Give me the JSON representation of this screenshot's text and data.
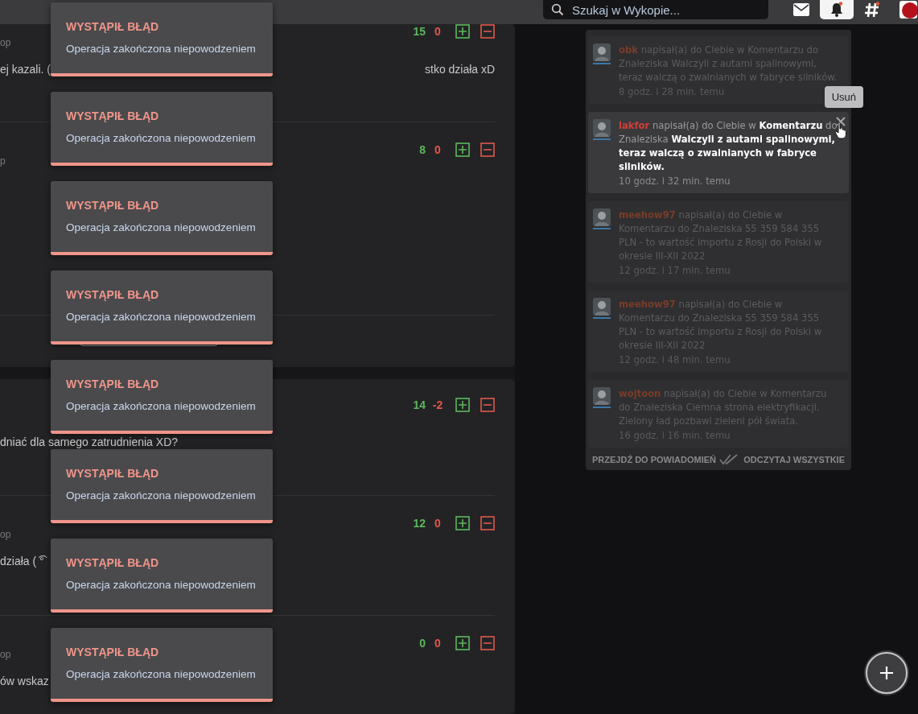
{
  "topbar": {
    "search": {
      "placeholder": "Szukaj w Wykopie..."
    },
    "nav": [
      {
        "kind": "mail",
        "selected": false
      },
      {
        "kind": "bell",
        "selected": true
      },
      {
        "kind": "hashtag",
        "selected": false
      },
      {
        "kind": "avatar",
        "selected": false
      }
    ]
  },
  "cards": [
    {
      "comments": [
        {
          "meta": "op",
          "text_parts": [
            "ej kazali. (",
            "stko działa xD"
          ],
          "votes_up": "15",
          "votes_down": "0"
        },
        {
          "meta": "p",
          "votes_up": "8",
          "votes_down": "0"
        }
      ],
      "more_button": true
    },
    {
      "comments": [
        {
          "text_parts": [
            "dniać dla samego zatrudnienia XD?"
          ],
          "votes_up": "14",
          "votes_down": "-2"
        },
        {
          "meta": "op",
          "text_parts": [
            "działa ( ͡°"
          ],
          "votes_up": "12",
          "votes_down": "0"
        },
        {
          "meta": "op",
          "text_parts": [
            "ów wskaz"
          ],
          "votes_up": "0",
          "votes_down": "0"
        }
      ],
      "more_button": false
    }
  ],
  "notifications": {
    "items": [
      {
        "author": "obk",
        "message": "napisał(a) do Ciebie w Komentarzu do Znaleziska Walczyli z autami spalinowymi, teraz walczą o zwalnianych w fabryce silników.",
        "time": "8 godz. i 28 min. temu",
        "highlighted": false
      },
      {
        "author": "lakfor",
        "message": "napisał(a) do Ciebie w **Komentarzu** do Znaleziska **Walczyli z autami spalinowymi, teraz walczą o zwalnianych w fabryce silników.**",
        "time": "10 godz. i 32 min. temu",
        "highlighted": true,
        "tooltip": "Usuń"
      },
      {
        "author": "meehow97",
        "message": "napisał(a) do Ciebie w Komentarzu do Znaleziska 55 359 584 355 PLN - to wartość importu z Rosji do Polski w okresie III-XII 2022",
        "time": "12 godz. i 17 min. temu",
        "highlighted": false
      },
      {
        "author": "meehow97",
        "message": "napisał(a) do Ciebie w Komentarzu do Znaleziska 55 359 584 355 PLN - to wartość importu z Rosji do Polski w okresie III-XII 2022",
        "time": "12 godz. i 48 min. temu",
        "highlighted": false
      },
      {
        "author": "wojtoon",
        "message": "napisał(a) do Ciebie w Komentarzu do Znaleziska Ciemna strona elektryfikacji. Zielony ład pozbawi zieleni pół świata.",
        "time": "16 godz. i 16 min. temu",
        "highlighted": false
      }
    ],
    "footer": {
      "link": "PRZEJDŹ DO POWIADOMIEŃ",
      "mark_all": "ODCZYTAJ WSZYSTKIE"
    }
  },
  "toasts": [
    {
      "title": "WYSTĄPIŁ BŁĄD",
      "message": "Operacja zakończona niepowodzeniem"
    },
    {
      "title": "WYSTĄPIŁ BŁĄD",
      "message": "Operacja zakończona niepowodzeniem"
    },
    {
      "title": "WYSTĄPIŁ BŁĄD",
      "message": "Operacja zakończona niepowodzeniem"
    },
    {
      "title": "WYSTĄPIŁ BŁĄD",
      "message": "Operacja zakończona niepowodzeniem"
    },
    {
      "title": "WYSTĄPIŁ BŁĄD",
      "message": "Operacja zakończona niepowodzeniem"
    },
    {
      "title": "WYSTĄPIŁ BŁĄD",
      "message": "Operacja zakończona niepowodzeniem"
    },
    {
      "title": "WYSTĄPIŁ BŁĄD",
      "message": "Operacja zakończona niepowodzeniem"
    },
    {
      "title": "WYSTĄPIŁ BŁĄD",
      "message": "Operacja zakończona niepowodzeniem"
    }
  ]
}
